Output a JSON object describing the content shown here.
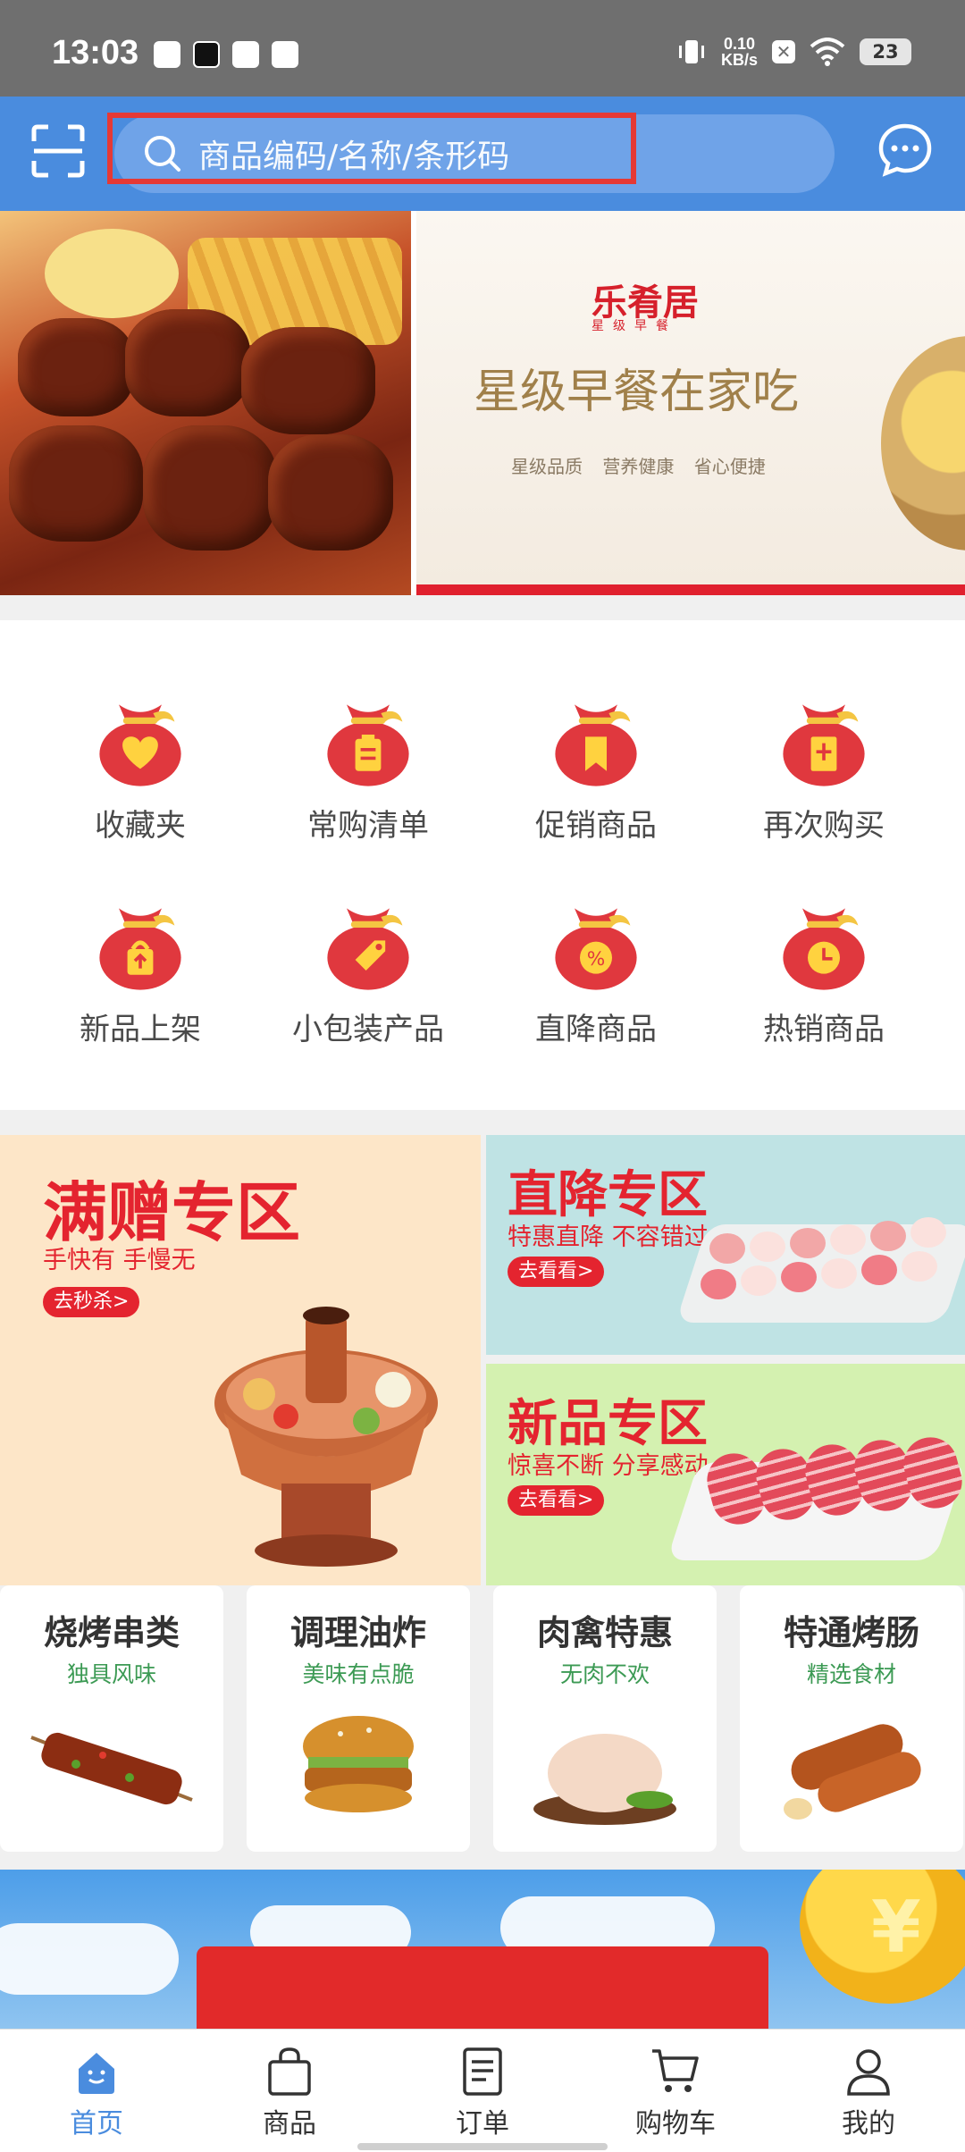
{
  "status_bar": {
    "time": "13:03",
    "net_speed_value": "0.10",
    "net_speed_unit": "KB/s",
    "battery": "23"
  },
  "header": {
    "search_placeholder": "商品编码/名称/条形码",
    "accent_color": "#4a8cde"
  },
  "banner": {
    "brand": "乐肴居",
    "brand_sub": "星级早餐",
    "title": "星级早餐在家吃",
    "tags": "星级品质 营养健康 省心便捷",
    "slide_count": 6,
    "active_slide_index": 4
  },
  "shortcuts": [
    {
      "label": "收藏夹",
      "icon": "heart-bag-icon"
    },
    {
      "label": "常购清单",
      "icon": "list-bag-icon"
    },
    {
      "label": "促销商品",
      "icon": "bookmark-bag-icon"
    },
    {
      "label": "再次购买",
      "icon": "receipt-bag-icon"
    },
    {
      "label": "新品上架",
      "icon": "new-bag-icon"
    },
    {
      "label": "小包装产品",
      "icon": "tag-bag-icon"
    },
    {
      "label": "直降商品",
      "icon": "discount-bag-icon"
    },
    {
      "label": "热销商品",
      "icon": "clock-bag-icon"
    }
  ],
  "promos": {
    "manzeng": {
      "title": "满赠专区",
      "sub": "手快有 手慢无",
      "button": "去秒杀>"
    },
    "zhijiang": {
      "title": "直降专区",
      "sub": "特惠直降 不容错过",
      "button": "去看看>"
    },
    "xinpin": {
      "title": "新品专区",
      "sub": "惊喜不断 分享感动",
      "button": "去看看>"
    }
  },
  "categories": [
    {
      "title": "烧烤串类",
      "sub": "独具风味"
    },
    {
      "title": "调理油炸",
      "sub": "美味有点脆"
    },
    {
      "title": "肉禽特惠",
      "sub": "无肉不欢"
    },
    {
      "title": "特通烤肠",
      "sub": "精选食材"
    }
  ],
  "bottom_nav": [
    {
      "label": "首页",
      "icon": "home-icon",
      "active": true
    },
    {
      "label": "商品",
      "icon": "bag-icon",
      "active": false
    },
    {
      "label": "订单",
      "icon": "order-icon",
      "active": false
    },
    {
      "label": "购物车",
      "icon": "cart-icon",
      "active": false
    },
    {
      "label": "我的",
      "icon": "user-icon",
      "active": false
    }
  ]
}
